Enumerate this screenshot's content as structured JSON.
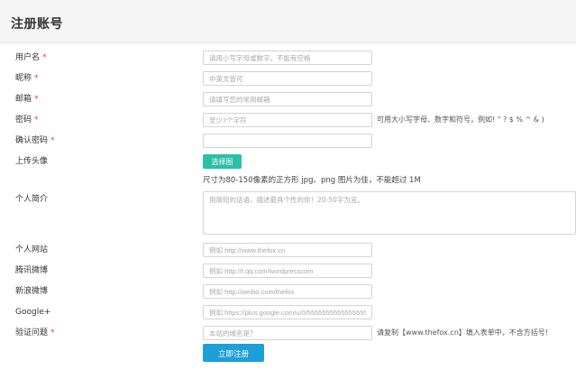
{
  "page": {
    "title": "注册账号"
  },
  "form": {
    "username": {
      "label": "用户名",
      "required": "*",
      "placeholder": "请用小写字母或数字，不能有空格"
    },
    "nickname": {
      "label": "昵称",
      "required": "*",
      "placeholder": "中英文皆可"
    },
    "email": {
      "label": "邮箱",
      "required": "*",
      "placeholder": "请填写您的常用邮箱"
    },
    "password": {
      "label": "密码",
      "required": "*",
      "placeholder": "至少7个字符",
      "hint": "可用大小写字母、数字和符号，例如! \" ? $ % ^ & )"
    },
    "confirm_password": {
      "label": "确认密码",
      "required": "*",
      "placeholder": ""
    },
    "avatar": {
      "label": "上传头像",
      "button": "选择图像",
      "note": "尺寸为80-150像素的正方形 jpg、png 图片为佳，不能超过 1M"
    },
    "bio": {
      "label": "个人简介",
      "placeholder": "用简短的话语，描述最具个性的你！20-50字为宜。"
    },
    "website": {
      "label": "个人网站",
      "placeholder": "例如 http://www.thefox.cn"
    },
    "tencent_weibo": {
      "label": "腾讯微博",
      "placeholder": "例如 http://t.qq.com/wordpresscom"
    },
    "sina_weibo": {
      "label": "新浪微博",
      "placeholder": "例如 http://weibo.com/thefox"
    },
    "google_plus": {
      "label": "Google+",
      "placeholder": "例如 https://plus.google.com/u/0/555555555555555555"
    },
    "captcha": {
      "label": "验证问题",
      "required": "*",
      "placeholder": "本站的域名是？",
      "hint": "请复制【www.thefox.cn】填入表单中，不含方括号!"
    },
    "submit_label": "立即注册"
  }
}
